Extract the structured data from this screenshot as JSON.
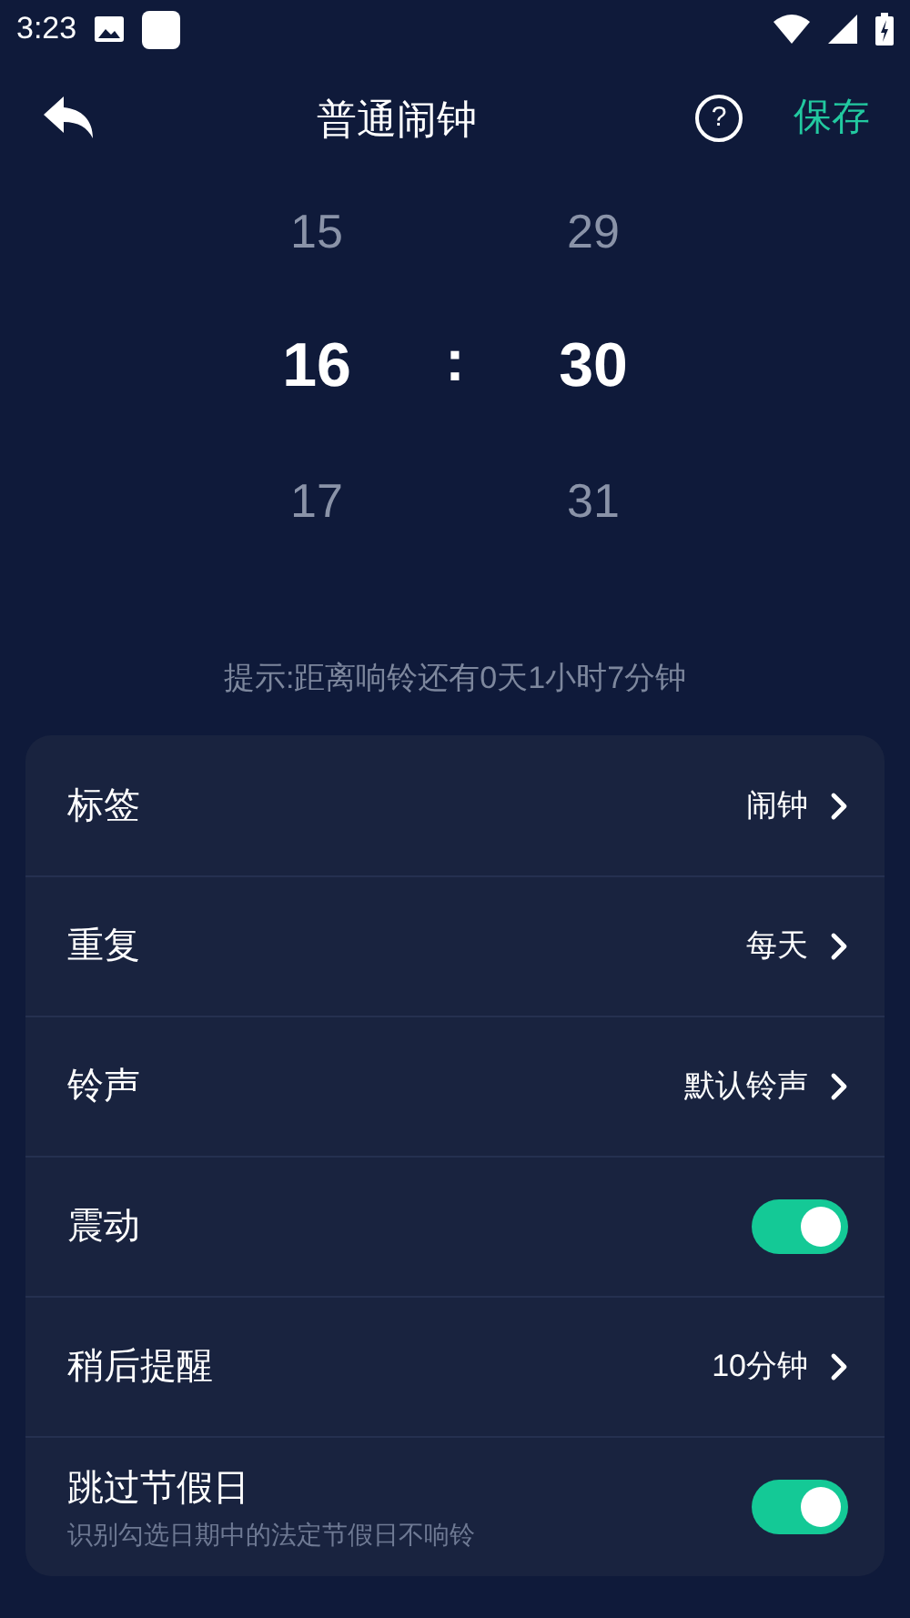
{
  "status_bar": {
    "time": "3:23"
  },
  "header": {
    "title": "普通闹钟",
    "help": "?",
    "save": "保存"
  },
  "picker": {
    "separator": ":",
    "hours": [
      {
        "value": "15",
        "selected": false
      },
      {
        "value": "16",
        "selected": true
      },
      {
        "value": "17",
        "selected": false
      }
    ],
    "minutes": [
      {
        "value": "29",
        "selected": false
      },
      {
        "value": "30",
        "selected": true
      },
      {
        "value": "31",
        "selected": false
      }
    ]
  },
  "hint": "提示:距离响铃还有0天1小时7分钟",
  "settings": [
    {
      "kind": "link",
      "label": "标签",
      "value": "闹钟"
    },
    {
      "kind": "link",
      "label": "重复",
      "value": "每天"
    },
    {
      "kind": "link",
      "label": "铃声",
      "value": "默认铃声"
    },
    {
      "kind": "toggle",
      "label": "震动",
      "on": true
    },
    {
      "kind": "link",
      "label": "稍后提醒",
      "value": "10分钟"
    },
    {
      "kind": "toggle",
      "label": "跳过节假日",
      "description": "识别勾选日期中的法定节假日不响铃",
      "on": true
    }
  ]
}
